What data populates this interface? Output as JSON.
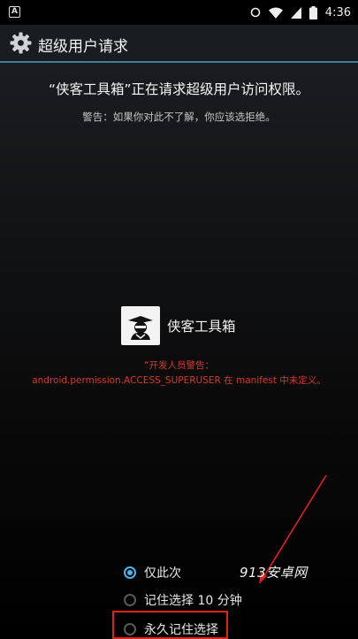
{
  "status_bar": {
    "time": "4:36",
    "notification_glyph": "A"
  },
  "app_bar": {
    "title": "超级用户请求"
  },
  "request": {
    "headline": "“侠客工具箱”正在请求超级用户访问权限。",
    "warning": "警告：如果你对此不了解，你应该选拒绝。"
  },
  "app": {
    "name": "侠客工具箱"
  },
  "developer_warning": {
    "line1": "“开发人员警告：",
    "line2": "android.permission.ACCESS_SUPERUSER 在 manifest 中未定义。"
  },
  "options": [
    {
      "label": "仅此次",
      "selected": true
    },
    {
      "label": "记住选择 10 分钟",
      "selected": false
    },
    {
      "label": "永久记住选择",
      "selected": false
    }
  ],
  "watermark": "913安卓网",
  "colors": {
    "accent": "#4fb3e8",
    "warning_red": "#d63a2a",
    "highlight_red": "#e0221e",
    "divider": "#3e7e96"
  }
}
